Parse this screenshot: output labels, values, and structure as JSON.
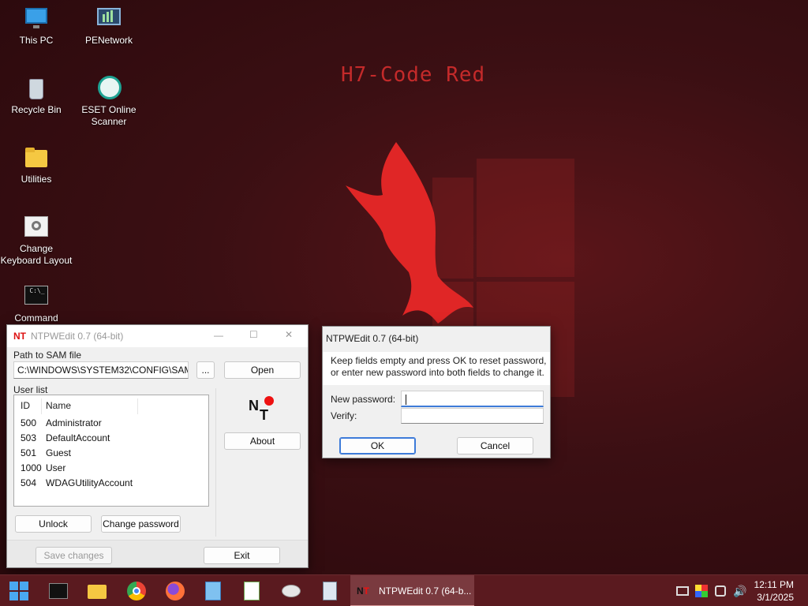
{
  "desktop": {
    "wallpaper_title": "H7-Code Red",
    "icons": [
      {
        "label": "This PC"
      },
      {
        "label": "PENetwork"
      },
      {
        "label": "Recycle Bin"
      },
      {
        "label": "ESET Online Scanner"
      },
      {
        "label": "Utilities"
      },
      {
        "label": "Change Keyboard Layout"
      },
      {
        "label": "Command"
      }
    ]
  },
  "main_window": {
    "title": "NTPWEdit 0.7 (64-bit)",
    "sam_label": "Path to SAM file",
    "sam_path": "C:\\WINDOWS\\SYSTEM32\\CONFIG\\SAM",
    "browse_label": "...",
    "open_label": "Open",
    "userlist_label": "User list",
    "columns": [
      "ID",
      "Name"
    ],
    "users": [
      {
        "id": "500",
        "name": "Administrator"
      },
      {
        "id": "503",
        "name": "DefaultAccount"
      },
      {
        "id": "501",
        "name": "Guest"
      },
      {
        "id": "1000",
        "name": "User"
      },
      {
        "id": "504",
        "name": "WDAGUtilityAccount"
      }
    ],
    "about_label": "About",
    "unlock_label": "Unlock",
    "change_password_label": "Change password",
    "save_label": "Save changes",
    "exit_label": "Exit",
    "controls": {
      "minimize": "—",
      "maximize": "☐",
      "close": "✕"
    }
  },
  "dialog": {
    "title": "NTPWEdit 0.7 (64-bit)",
    "message_line1": "Keep fields empty and press OK to reset password,",
    "message_line2": "or enter new password into both fields to change it.",
    "new_password_label": "New password:",
    "new_password_value": "",
    "verify_label": "Verify:",
    "verify_value": "",
    "ok_label": "OK",
    "cancel_label": "Cancel"
  },
  "taskbar": {
    "active_app_label": "NTPWEdit 0.7 (64-b...",
    "time": "12:11 PM",
    "date": "3/1/2025"
  },
  "colors": {
    "accent": "#3d7bd9",
    "taskbar": "#5a1a1f",
    "wallpaper": "#3b0f13"
  }
}
